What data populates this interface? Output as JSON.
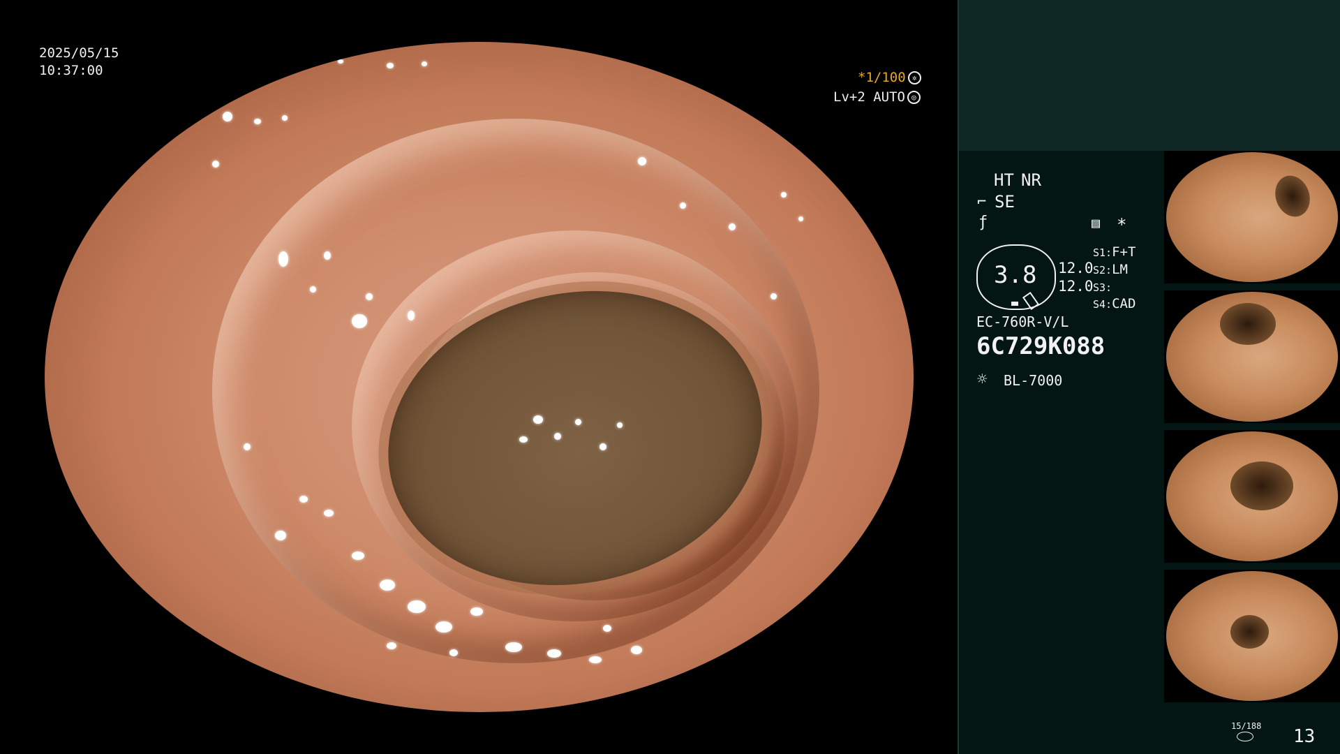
{
  "datetime": {
    "date": "2025/05/15",
    "time": "10:37:00"
  },
  "exposure": {
    "shutter": "*1/100",
    "shutter_icon": "aperture-icon",
    "level": "Lv+2 AUTO",
    "level_icon": "iris-icon"
  },
  "settings": {
    "ht": "HT",
    "nr": "NR",
    "se": "SE",
    "se_icon": "structure-enhance-icon",
    "color_icon": "color-mode-icon",
    "memo_icon": "memo-icon",
    "star": "*"
  },
  "gauge": {
    "value": "3.8",
    "n1": "12.0",
    "n2": "12.0"
  },
  "switches": [
    {
      "label": "S1:",
      "value": "F+T"
    },
    {
      "label": "S2:",
      "value": "LM"
    },
    {
      "label": "S3:",
      "value": ""
    },
    {
      "label": "S4:",
      "value": "CAD"
    }
  ],
  "scope": {
    "model": "EC-760R-V/L",
    "serial": "6C729K088"
  },
  "light_source": {
    "icon": "light-source-icon",
    "label": "BL-7000"
  },
  "capture_count": "15/188",
  "page_number": "13",
  "thumbnails": [
    {
      "id": "1"
    },
    {
      "id": "2"
    },
    {
      "id": "3"
    },
    {
      "id": "4"
    }
  ],
  "colors": {
    "accent": "#e7a824",
    "panel": "#041614",
    "panel_top": "#0e2624"
  }
}
